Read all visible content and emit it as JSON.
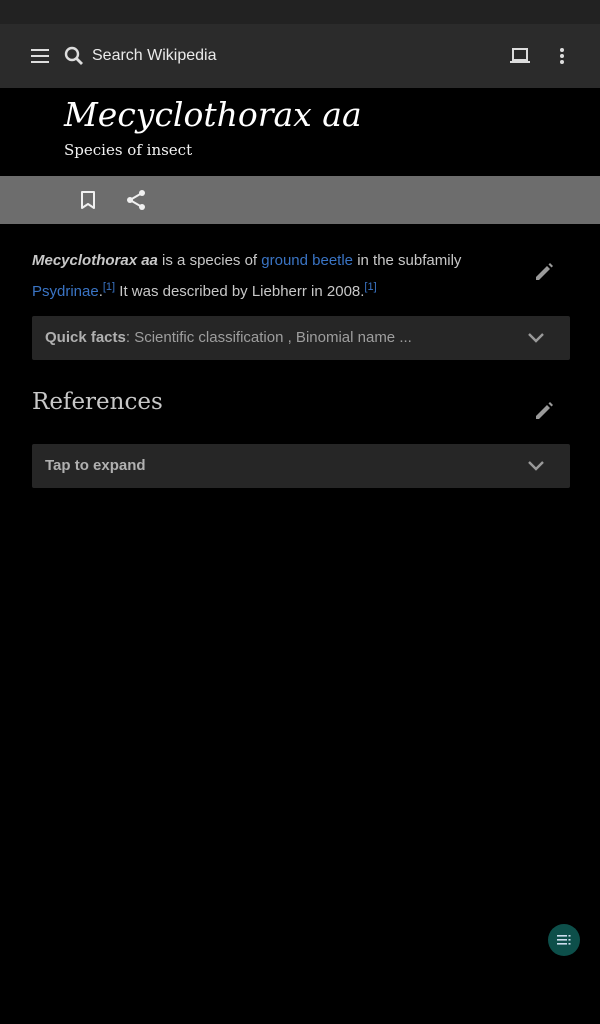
{
  "toolbar": {
    "search_placeholder": "Search Wikipedia",
    "icons": [
      "menu-icon",
      "search-icon",
      "tabs-icon",
      "more-vert-icon"
    ]
  },
  "article": {
    "title": "Mecyclothorax aa",
    "subtitle": "Species of insect",
    "lead": {
      "bold_name": "Mecyclothorax aa",
      "text_1": " is a species of ",
      "link_1": "ground beetle",
      "text_2": " in the subfamily ",
      "link_2": "Psydrinae",
      "text_3": ".",
      "ref_1": "[1]",
      "text_4": " It was described by Liebherr in 2008.",
      "ref_2": "[1]"
    },
    "quick_facts": {
      "label": "Quick facts",
      "summary": ": Scientific classification , Binomial name ..."
    },
    "references": {
      "heading": "References",
      "expand_label": "Tap to expand"
    }
  },
  "colors": {
    "link": "#3a74c4",
    "toolbar_bg": "#2b2b2b",
    "action_bar_bg": "#6d6d6d",
    "fab_bg": "#0d4f4a"
  }
}
